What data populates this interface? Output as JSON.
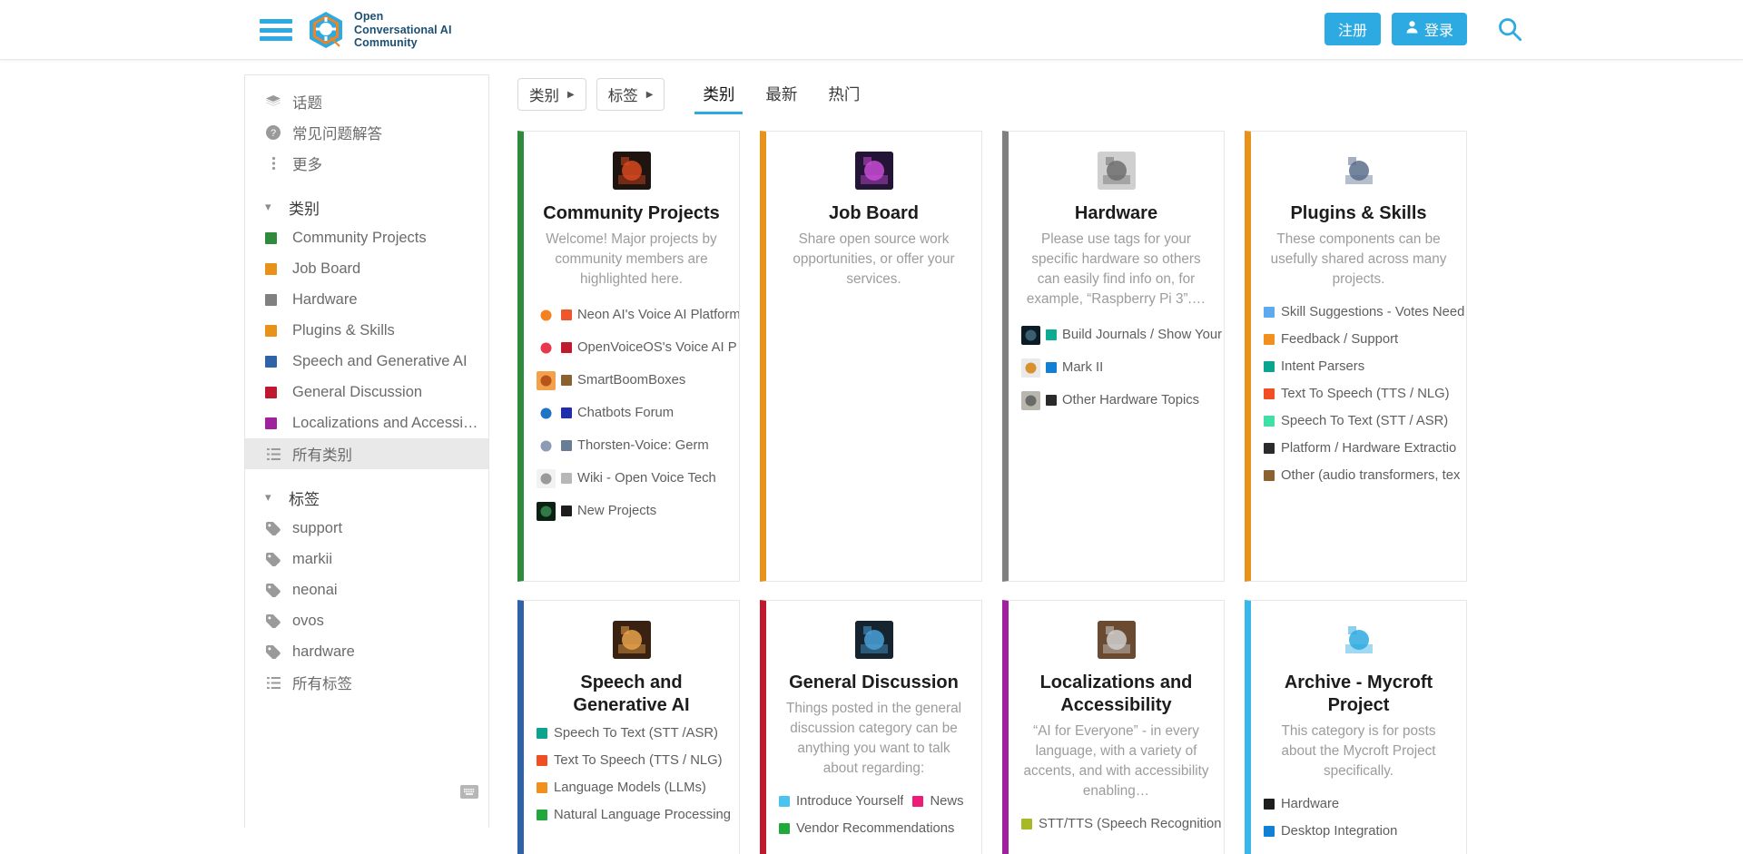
{
  "header": {
    "brand_lines": [
      "Open",
      "Conversational AI",
      "Community"
    ],
    "signup_label": "注册",
    "login_label": "登录",
    "search_icon": "search-icon",
    "accent_color": "#2daae1"
  },
  "sidebar": {
    "top_items": [
      {
        "label": "话题",
        "icon": "layers-icon"
      },
      {
        "label": "常见问题解答",
        "icon": "question-circle-icon"
      },
      {
        "label": "更多",
        "icon": "ellipsis-vertical-icon"
      }
    ],
    "categories_section": {
      "label": "类别",
      "chevron": "chevron-down-icon"
    },
    "categories": [
      {
        "label": "Community Projects",
        "color": "#2e8b3e"
      },
      {
        "label": "Job Board",
        "color": "#e8921a"
      },
      {
        "label": "Hardware",
        "color": "#808080"
      },
      {
        "label": "Plugins & Skills",
        "color": "#e8921a"
      },
      {
        "label": "Speech and Generative AI",
        "color": "#2f62a8"
      },
      {
        "label": "General Discussion",
        "color": "#c0192f"
      },
      {
        "label": "Localizations and Accessi…",
        "color": "#a0219e"
      }
    ],
    "all_categories": {
      "label": "所有类别",
      "icon": "list-icon",
      "active": true
    },
    "tags_section": {
      "label": "标签",
      "chevron": "chevron-down-icon"
    },
    "tags": [
      {
        "label": "support",
        "icon": "tag-icon"
      },
      {
        "label": "markii",
        "icon": "tag-icon"
      },
      {
        "label": "neonai",
        "icon": "tag-icon"
      },
      {
        "label": "ovos",
        "icon": "tag-icon"
      },
      {
        "label": "hardware",
        "icon": "tag-icon"
      }
    ],
    "all_tags": {
      "label": "所有标签",
      "icon": "list-icon"
    },
    "keyboard_icon": "keyboard-icon"
  },
  "main": {
    "filters": [
      {
        "label": "类别",
        "caret": "caret-right-icon"
      },
      {
        "label": "标签",
        "caret": "caret-right-icon"
      }
    ],
    "tabs": [
      {
        "label": "类别",
        "active": true
      },
      {
        "label": "最新",
        "active": false
      },
      {
        "label": "热门",
        "active": false
      }
    ],
    "cards": [
      {
        "title": "Community Projects",
        "description": "Welcome! Major projects by community members are highlighted here.",
        "stripe": "#2e8b3e",
        "logo_name": "community-projects-logo",
        "logo_bg": "#1e1410",
        "logo_accent": "#d9481e",
        "subcategories": [
          {
            "label": "Neon AI's Voice AI Platform",
            "color": "#ef562d",
            "logo": "neon-ai-logo",
            "logo_bg": "#ffffff",
            "logo_accent": "#f58220"
          },
          {
            "label": "OpenVoiceOS's Voice AI P",
            "color": "#c0192f",
            "logo": "openvoiceos-logo",
            "logo_bg": "#ffffff",
            "logo_accent": "#e8384f"
          },
          {
            "label": "SmartBoomBoxes",
            "color": "#8a6230",
            "logo": "smartboomboxes-logo",
            "logo_bg": "#f3a24b",
            "logo_accent": "#b8541a"
          },
          {
            "label": "Chatbots Forum",
            "color": "#1f2dae",
            "logo": "chatbots-forum-logo",
            "logo_bg": "#ffffff",
            "logo_accent": "#1d74c4"
          },
          {
            "label": "Thorsten-Voice: Germ",
            "color": "#6b7c96",
            "logo": "thorsten-voice-logo",
            "logo_bg": "#ffffff",
            "logo_accent": "#8d9cb5"
          },
          {
            "label": "Wiki - Open Voice Tech",
            "color": "#b7b7b7",
            "logo": "open-voice-tech-wiki-logo",
            "logo_bg": "#f2f2f2",
            "logo_accent": "#9a9a9a"
          },
          {
            "label": "New Projects",
            "color": "#1d1d1d",
            "logo": "new-projects-logo",
            "logo_bg": "#0d2014",
            "logo_accent": "#2f7a46"
          }
        ]
      },
      {
        "title": "Job Board",
        "description": "Share open source work opportunities, or offer your services.",
        "stripe": "#e8921a",
        "logo_name": "job-board-logo",
        "logo_bg": "#241536",
        "logo_accent": "#c84bd6",
        "subcategories": []
      },
      {
        "title": "Hardware",
        "description": "Please use tags for your specific hardware so others can easily find info on, for example, “Raspberry Pi 3”.…",
        "stripe": "#808080",
        "logo_name": "hardware-logo",
        "logo_bg": "#cfcfcf",
        "logo_accent": "#6f6f6f",
        "subcategories": [
          {
            "label": "Build Journals / Show Your",
            "color": "#0eab93",
            "logo": "build-journals-logo",
            "logo_bg": "#0c1c24",
            "logo_accent": "#3a5e72"
          },
          {
            "label": "Mark II",
            "color": "#1180d4",
            "logo": "mark-ii-logo",
            "logo_bg": "#e9e9e9",
            "logo_accent": "#d9912f"
          },
          {
            "label": "Other Hardware Topics",
            "color": "#2a2a2a",
            "logo": "other-hardware-logo",
            "logo_bg": "#b9b6ad",
            "logo_accent": "#6a6a6a"
          }
        ]
      },
      {
        "title": "Plugins & Skills",
        "description": "These components can be usefully shared across many projects.",
        "stripe": "#e8921a",
        "logo_name": "brain-icon",
        "logo_bg": "#ffffff",
        "logo_accent": "#5b6e8c",
        "subcategories": [
          {
            "label": "Skill Suggestions - Votes Need",
            "color": "#5fa9ee"
          },
          {
            "label": "Feedback / Support",
            "color": "#f0911e"
          },
          {
            "label": "Intent Parsers",
            "color": "#0ba58f"
          },
          {
            "label": "Text To Speech (TTS / NLG)",
            "color": "#f04e23"
          },
          {
            "label": "Speech To Text (STT / ASR)",
            "color": "#3fe0a5"
          },
          {
            "label": "Platform / Hardware Extractio",
            "color": "#2b2b2b"
          },
          {
            "label": "Other (audio transformers, tex",
            "color": "#8a6230"
          }
        ]
      },
      {
        "title": "Speech and Generative AI",
        "description": "",
        "stripe": "#2f62a8",
        "logo_name": "speech-generative-ai-logo",
        "logo_bg": "#3a2212",
        "logo_accent": "#e8a24b",
        "subcategories": [
          {
            "label": "Speech To Text (STT /ASR)",
            "color": "#0ba58f"
          },
          {
            "label": "Text To Speech (TTS / NLG)",
            "color": "#f04e23"
          },
          {
            "label": "Language Models (LLMs)",
            "color": "#f0911e"
          },
          {
            "label": "Natural Language Processing",
            "color": "#22a73c"
          }
        ]
      },
      {
        "title": "General Discussion",
        "description": "Things posted in the general discussion category can be anything you want to talk about regarding:",
        "stripe": "#c0192f",
        "logo_name": "general-discussion-logo",
        "logo_bg": "#15242f",
        "logo_accent": "#4aa0d8",
        "subcategories": [
          {
            "label": "Introduce Yourself",
            "color": "#4cc3ef"
          },
          {
            "label": "News",
            "color": "#ee1b7a"
          },
          {
            "label": "Vendor Recommendations",
            "color": "#22a73c"
          }
        ]
      },
      {
        "title": "Localizations and Accessibility",
        "description": "“AI for Everyone” - in every language, with a variety of accents, and with accessibility enabling…",
        "stripe": "#a0219e",
        "logo_name": "localizations-accessibility-logo",
        "logo_bg": "#6b4a32",
        "logo_accent": "#cfcfcf",
        "subcategories": [
          {
            "label": "STT/TTS (Speech Recognition",
            "color": "#a8b827"
          }
        ]
      },
      {
        "title": "Archive - Mycroft Project",
        "description": "This category is for posts about the Mycroft Project specifically.",
        "stripe": "#39b6ea",
        "logo_name": "mycroft-logo",
        "logo_bg": "#ffffff",
        "logo_accent": "#2daae1",
        "subcategories": [
          {
            "label": "Hardware",
            "color": "#1d1d1d"
          },
          {
            "label": "Desktop Integration",
            "color": "#1180d4"
          }
        ]
      }
    ]
  }
}
